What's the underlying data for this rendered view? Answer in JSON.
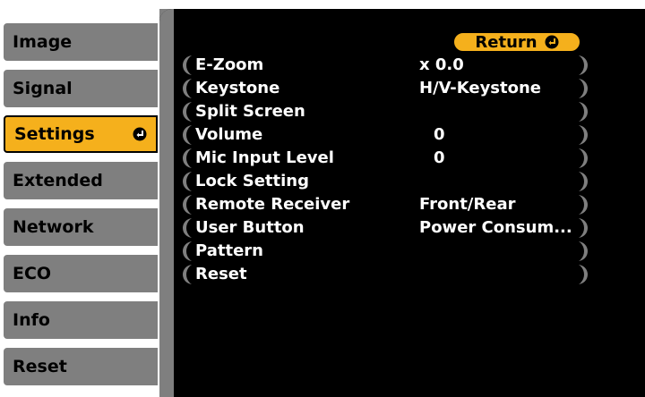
{
  "tabs": [
    {
      "label": "Image",
      "active": false
    },
    {
      "label": "Signal",
      "active": false
    },
    {
      "label": "Settings",
      "active": true
    },
    {
      "label": "Extended",
      "active": false
    },
    {
      "label": "Network",
      "active": false
    },
    {
      "label": "ECO",
      "active": false
    },
    {
      "label": "Info",
      "active": false
    },
    {
      "label": "Reset",
      "active": false
    }
  ],
  "return_label": "Return",
  "menu": [
    {
      "label": "E-Zoom",
      "value": "x  0.0"
    },
    {
      "label": "Keystone",
      "value": "H/V-Keystone"
    },
    {
      "label": "Split Screen",
      "value": ""
    },
    {
      "label": "Volume",
      "value": "0"
    },
    {
      "label": "Mic Input Level",
      "value": "0"
    },
    {
      "label": "Lock Setting",
      "value": ""
    },
    {
      "label": "Remote Receiver",
      "value": "Front/Rear"
    },
    {
      "label": "User Button",
      "value": "Power Consum..."
    },
    {
      "label": "Pattern",
      "value": ""
    },
    {
      "label": "Reset",
      "value": ""
    }
  ],
  "colors": {
    "accent": "#f5b01c",
    "tab": "#7f7f7f",
    "panel": "#000000",
    "text": "#ffffff"
  }
}
